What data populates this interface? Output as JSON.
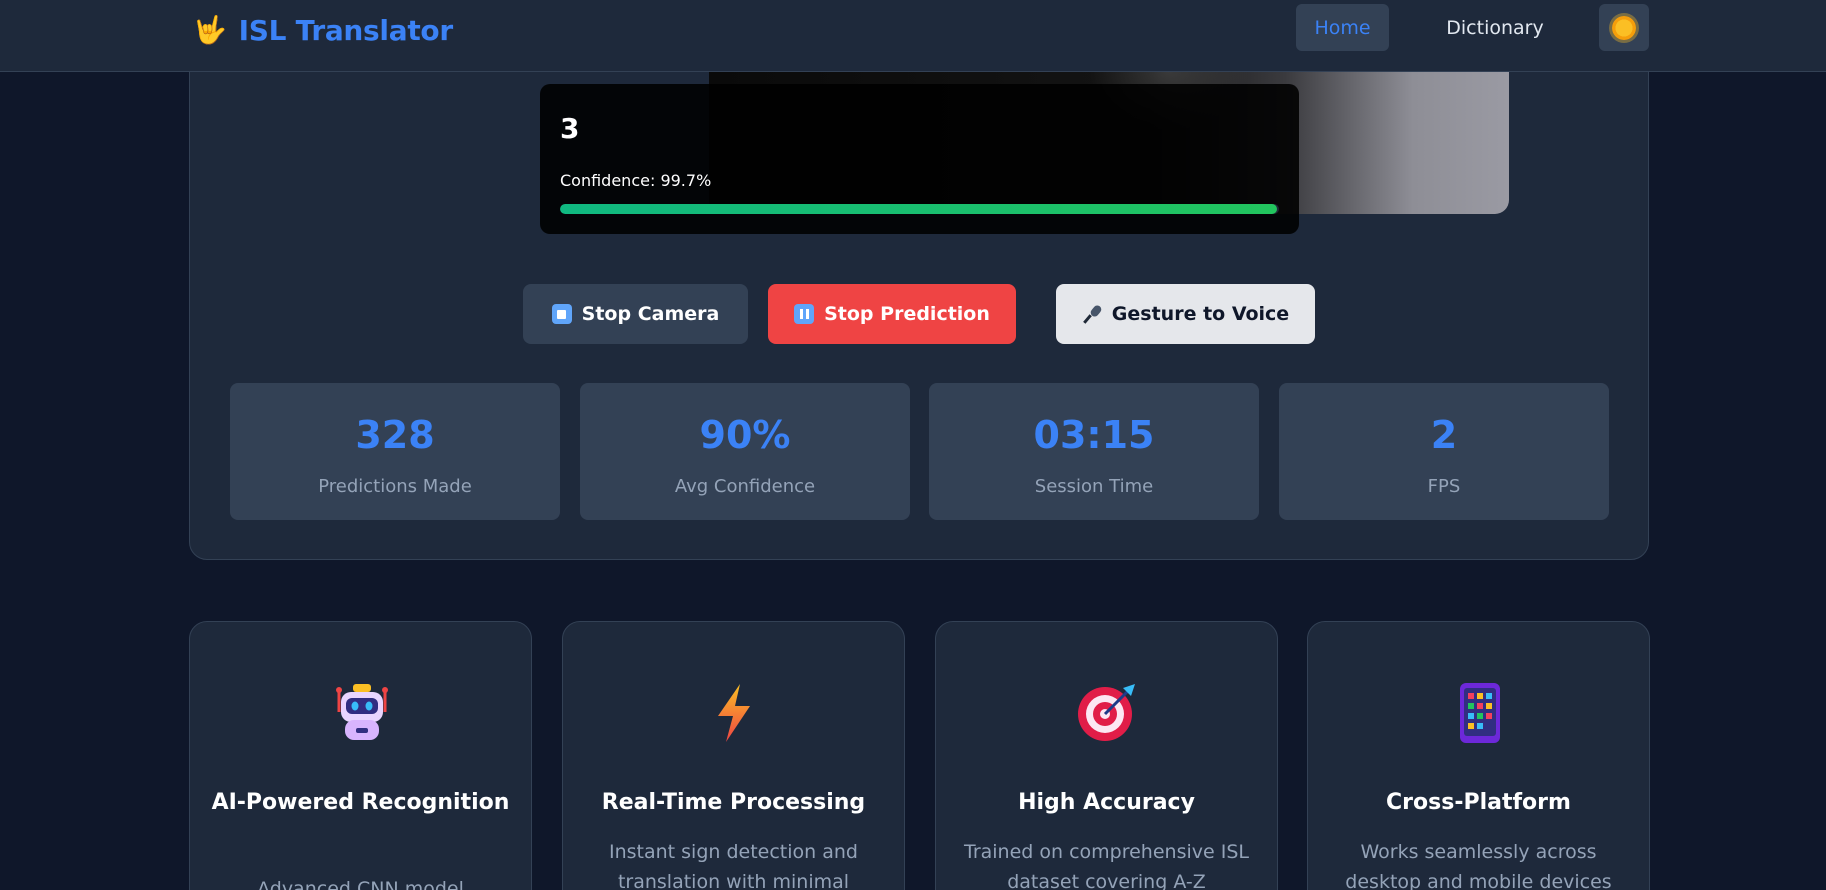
{
  "nav": {
    "brand_icon": "🤟",
    "brand": "ISL Translator",
    "links": [
      "Home",
      "Dictionary"
    ],
    "active": "Home",
    "theme_icon": "sun-icon"
  },
  "prediction": {
    "value": "3",
    "confidence_text": "Confidence: 99.7%",
    "confidence": 0.997
  },
  "controls": {
    "stop_camera": "Stop Camera",
    "stop_prediction": "Stop Prediction",
    "gesture_to_voice": "Gesture to Voice"
  },
  "stats": [
    {
      "value": "328",
      "label": "Predictions Made"
    },
    {
      "value": "90%",
      "label": "Avg Confidence"
    },
    {
      "value": "03:15",
      "label": "Session Time"
    },
    {
      "value": "2",
      "label": "FPS"
    }
  ],
  "features": [
    {
      "icon": "robot-icon",
      "title": "AI-Powered Recognition",
      "desc": "Advanced CNN model"
    },
    {
      "icon": "lightning-icon",
      "title": "Real-Time Processing",
      "desc": "Instant sign detection and translation with minimal"
    },
    {
      "icon": "target-icon",
      "title": "High Accuracy",
      "desc": "Trained on comprehensive ISL dataset covering A-Z"
    },
    {
      "icon": "mobile-icon",
      "title": "Cross-Platform",
      "desc": "Works seamlessly across desktop and mobile devices"
    }
  ],
  "colors": {
    "accent": "#3b82f6",
    "danger": "#ef4444",
    "success": "#10b981",
    "bg": "#0f172a",
    "card": "#1e293b"
  }
}
